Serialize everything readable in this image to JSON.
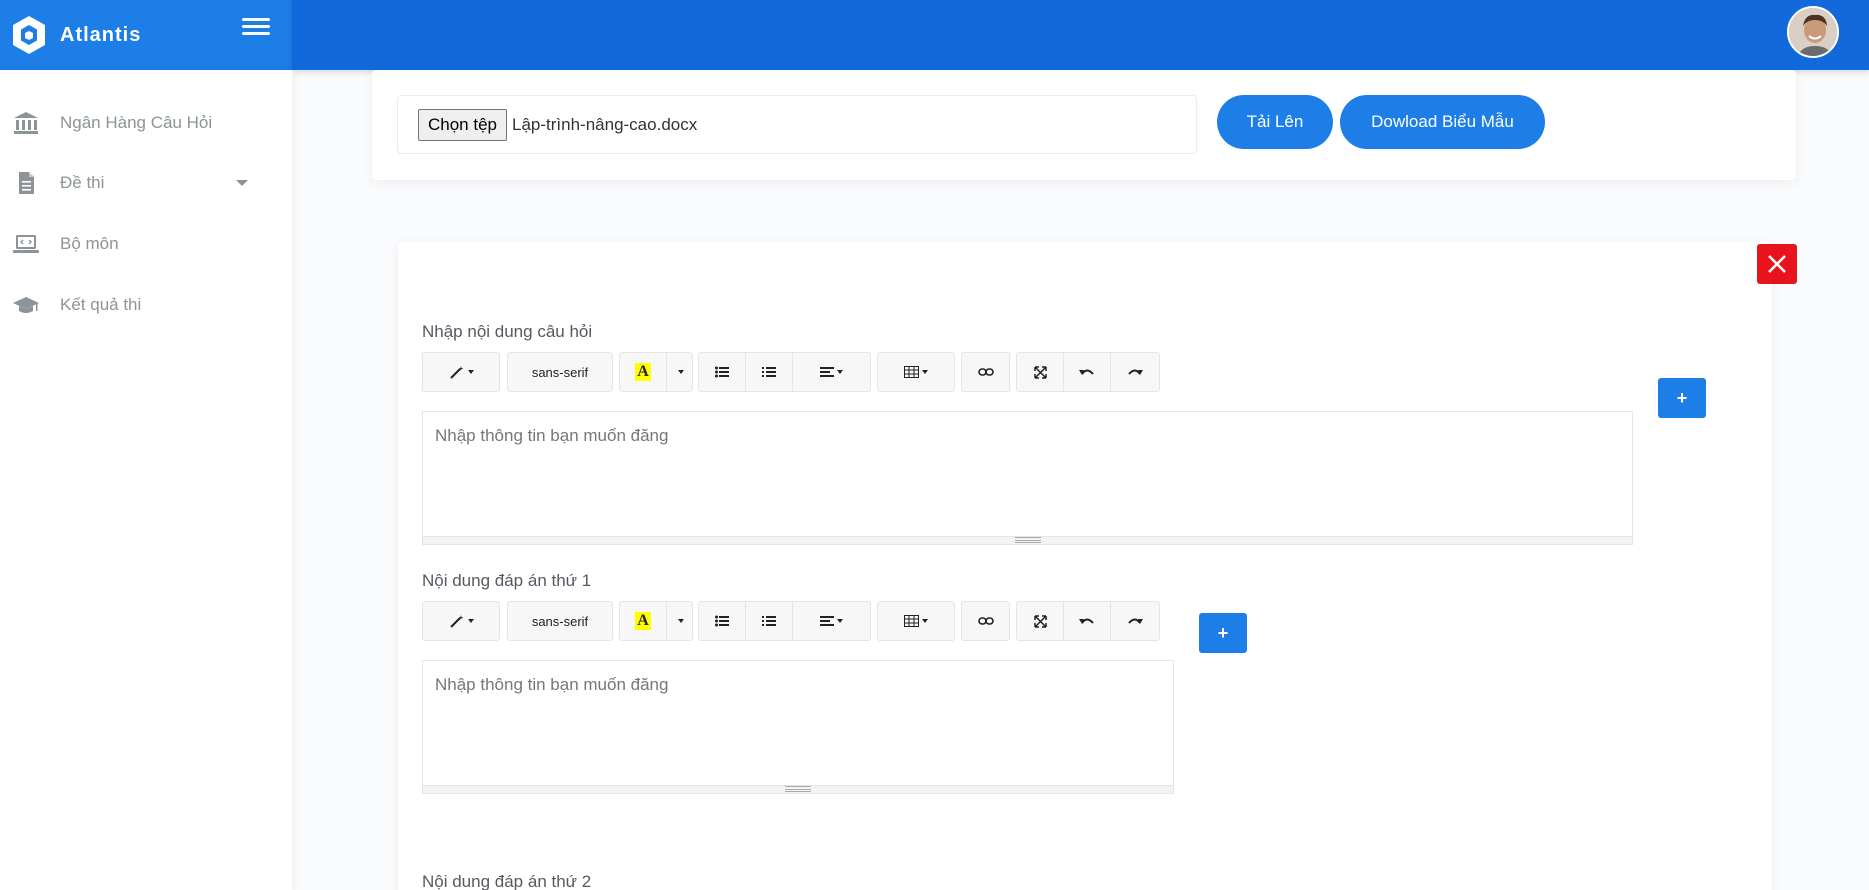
{
  "app": {
    "brand": "Atlantis"
  },
  "sidebar": {
    "items": [
      {
        "label": "Ngân Hàng Câu Hỏi",
        "icon": "bank-icon"
      },
      {
        "label": "Đề thi",
        "icon": "document-icon",
        "has_caret": true
      },
      {
        "label": "Bộ môn",
        "icon": "laptop-code-icon"
      },
      {
        "label": "Kết quả thi",
        "icon": "graduation-cap-icon"
      }
    ]
  },
  "upload": {
    "choose_file_label": "Chọn tệp",
    "file_name": "Lập-trình-nâng-cao.docx",
    "upload_button": "Tải Lên",
    "download_button": "Dowload Biểu Mẫu"
  },
  "question": {
    "content_label": "Nhập nội dung câu hỏi",
    "content_placeholder": "Nhập thông tin bạn muốn đăng",
    "answer1_label": "Nội dung đáp án thứ 1",
    "answer1_placeholder": "Nhập thông tin bạn muốn đăng",
    "answer2_label": "Nội dung đáp án thứ 2",
    "add_label": "+"
  },
  "editor_toolbar": {
    "font_name": "sans-serif",
    "color_letter": "A"
  },
  "colors": {
    "header": "#1269db",
    "logo_header": "#1d7ee8",
    "primary": "#1d7ee8",
    "danger": "#e8141d"
  }
}
